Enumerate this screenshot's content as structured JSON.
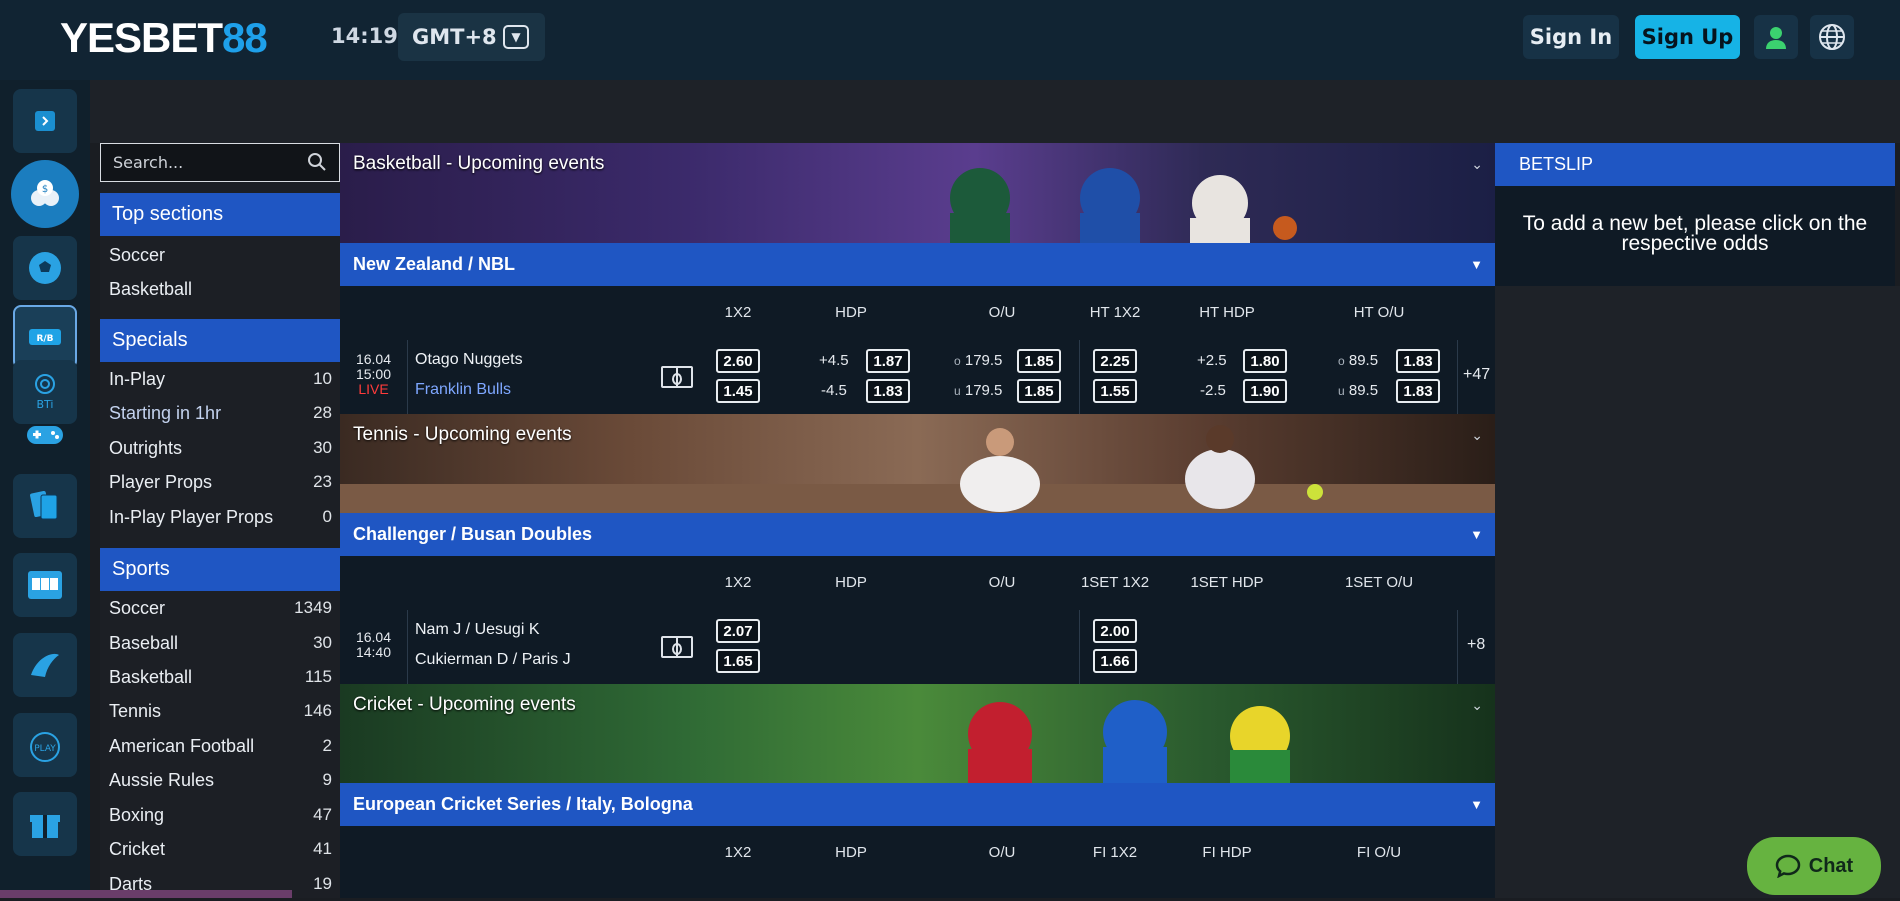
{
  "header": {
    "logo_main": "YESBET",
    "logo_accent": "88",
    "clock": "14:19",
    "timezone": "GMT+8",
    "signin": "Sign In",
    "signup": "Sign Up"
  },
  "rail": {
    "icons": [
      "collapse-icon",
      "casino-chips-icon",
      "soccer-ball-icon",
      "sportsbook-icon",
      "bti-icon",
      "gamepad-icon",
      "cards-icon",
      "slots-icon",
      "fishing-icon",
      "play-icon",
      "gift-icon"
    ],
    "bti_label": "BTi",
    "play_label": "PLAY"
  },
  "search": {
    "placeholder": "Search..."
  },
  "top_sections": {
    "title": "Top sections",
    "items": [
      {
        "label": "Soccer"
      },
      {
        "label": "Basketball"
      }
    ]
  },
  "specials": {
    "title": "Specials",
    "items": [
      {
        "label": "In-Play",
        "count": "10"
      },
      {
        "label": "Starting in 1hr",
        "count": "28"
      },
      {
        "label": "Outrights",
        "count": "30"
      },
      {
        "label": "Player Props",
        "count": "23"
      },
      {
        "label": "In-Play Player Props",
        "count": "0"
      }
    ]
  },
  "sports": {
    "title": "Sports",
    "items": [
      {
        "label": "Soccer",
        "count": "1349"
      },
      {
        "label": "Baseball",
        "count": "30"
      },
      {
        "label": "Basketball",
        "count": "115"
      },
      {
        "label": "Tennis",
        "count": "146"
      },
      {
        "label": "American Football",
        "count": "2"
      },
      {
        "label": "Aussie Rules",
        "count": "9"
      },
      {
        "label": "Boxing",
        "count": "47"
      },
      {
        "label": "Cricket",
        "count": "41"
      },
      {
        "label": "Darts",
        "count": "19"
      }
    ]
  },
  "events": [
    {
      "banner": "Basketball - Upcoming events",
      "league": "New Zealand / NBL",
      "cols": [
        "1X2",
        "HDP",
        "O/U",
        "HT 1X2",
        "HT HDP",
        "HT O/U"
      ],
      "match": {
        "date": "16.04",
        "time": "15:00",
        "status": "LIVE",
        "home": "Otago Nuggets",
        "away": "Franklin Bulls",
        "x12": [
          "2.60",
          "1.45"
        ],
        "hdp_lines": [
          "+4.5",
          "-4.5"
        ],
        "hdp_odds": [
          "1.87",
          "1.83"
        ],
        "ou_prefix": [
          "o",
          "u"
        ],
        "ou_lines": [
          "179.5",
          "179.5"
        ],
        "ou_odds": [
          "1.85",
          "1.85"
        ],
        "ht_x12": [
          "2.25",
          "1.55"
        ],
        "ht_hdp_lines": [
          "+2.5",
          "-2.5"
        ],
        "ht_hdp_odds": [
          "1.80",
          "1.90"
        ],
        "ht_ou_lines": [
          "89.5",
          "89.5"
        ],
        "ht_ou_odds": [
          "1.83",
          "1.83"
        ],
        "more": "+47"
      }
    },
    {
      "banner": "Tennis - Upcoming events",
      "league": "Challenger / Busan Doubles",
      "cols": [
        "1X2",
        "HDP",
        "O/U",
        "1SET 1X2",
        "1SET HDP",
        "1SET O/U"
      ],
      "match": {
        "date": "16.04",
        "time": "14:40",
        "home": "Nam J / Uesugi K",
        "away": "Cukierman D / Paris J",
        "x12": [
          "2.07",
          "1.65"
        ],
        "set_x12": [
          "2.00",
          "1.66"
        ],
        "more": "+8"
      }
    },
    {
      "banner": "Cricket - Upcoming events",
      "league": "European Cricket Series / Italy, Bologna",
      "cols": [
        "1X2",
        "HDP",
        "O/U",
        "FI 1X2",
        "FI HDP",
        "FI O/U"
      ]
    }
  ],
  "betslip": {
    "title": "BETSLIP",
    "message": "To add a new bet, please click on the respective odds"
  },
  "chat": {
    "label": "Chat"
  },
  "colors": {
    "accent": "#1f56c3",
    "signup": "#16b3e6",
    "chat": "#66b340",
    "live": "#ff3b3b"
  }
}
